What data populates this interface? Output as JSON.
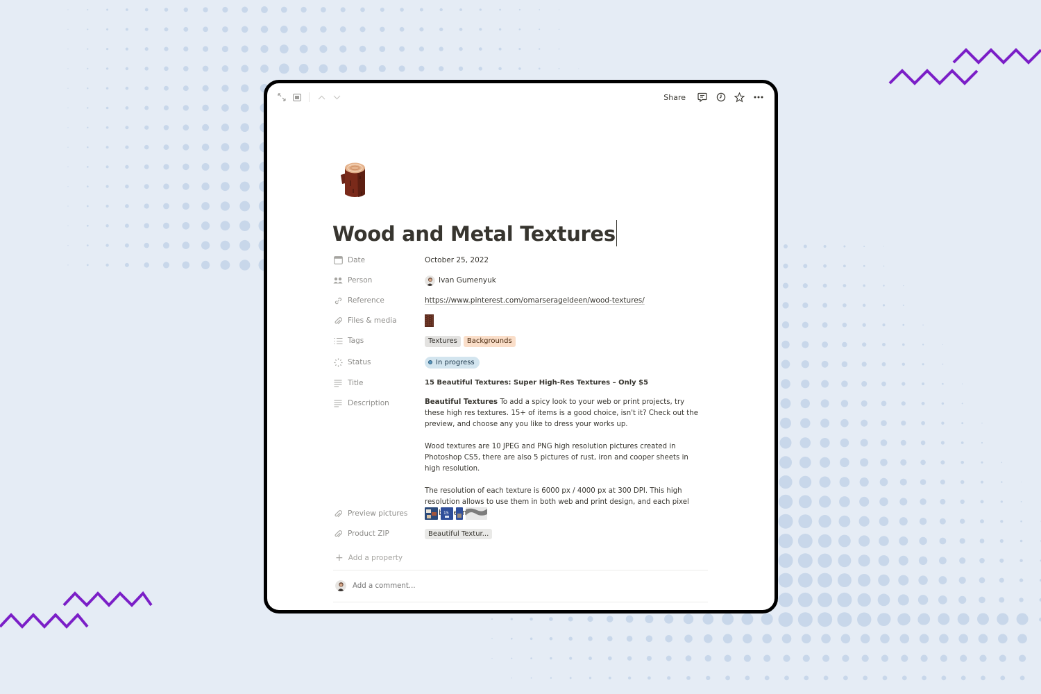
{
  "topbar": {
    "share_label": "Share",
    "left_icons": [
      "expand-icon",
      "peek-mode-icon",
      "chevron-up-icon",
      "chevron-down-icon"
    ],
    "right_icons": [
      "comment-icon",
      "history-clock-icon",
      "star-icon",
      "more-dots-icon"
    ]
  },
  "page": {
    "icon": "wood-log-icon",
    "title": "Wood and Metal Textures"
  },
  "properties": {
    "date": {
      "label": "Date",
      "icon": "calendar-icon",
      "value": "October 25, 2022"
    },
    "person": {
      "label": "Person",
      "icon": "people-icon",
      "value": "Ivan Gumenyuk"
    },
    "reference": {
      "label": "Reference",
      "icon": "link-icon",
      "value": "https://www.pinterest.com/omarserageldeen/wood-textures/"
    },
    "files": {
      "label": "Files & media",
      "icon": "paperclip-icon"
    },
    "tags": {
      "label": "Tags",
      "icon": "list-icon",
      "items": [
        {
          "name": "Textures",
          "bg": "#e3e2e0",
          "fg": "#32302c"
        },
        {
          "name": "Backgrounds",
          "bg": "#fadec9",
          "fg": "#49290e"
        }
      ]
    },
    "status": {
      "label": "Status",
      "icon": "status-spinner-icon",
      "value": "In progress",
      "color": "#5b97bd"
    },
    "title": {
      "label": "Title",
      "icon": "text-lines-icon",
      "value": "15 Beautiful Textures: Super High-Res Textures – Only $5"
    },
    "description": {
      "label": "Description",
      "icon": "text-lines-icon",
      "bold_lead": "Beautiful Textures",
      "p1": " To add a spicy look to your web or print projects, try these high res textures. 15+ of items is a good choice, isn't it? Check out the preview, and choose any you like to dress your works up.",
      "p2": "Wood textures are 10 JPEG and PNG high resolution pictures created in Photoshop CS5, there are also 5 pictures of rust, iron and cooper sheets in high resolution.",
      "p3": "The resolution of each texture is 6000 px / 4000 px at 300 DPI. This high resolution allows to use them in both web and print design, and each pixel will be seen."
    },
    "preview": {
      "label": "Preview pictures",
      "icon": "paperclip-icon"
    },
    "zip": {
      "label": "Product ZIP",
      "icon": "paperclip-icon",
      "value": "Beautiful Textur..."
    },
    "add_label": "Add a property"
  },
  "comment": {
    "placeholder": "Add a comment..."
  },
  "colors": {
    "background": "#e5ecf5",
    "dots": "#c8d7ea",
    "accent_zigzag": "#7b1fc7",
    "window_border": "#000000"
  }
}
